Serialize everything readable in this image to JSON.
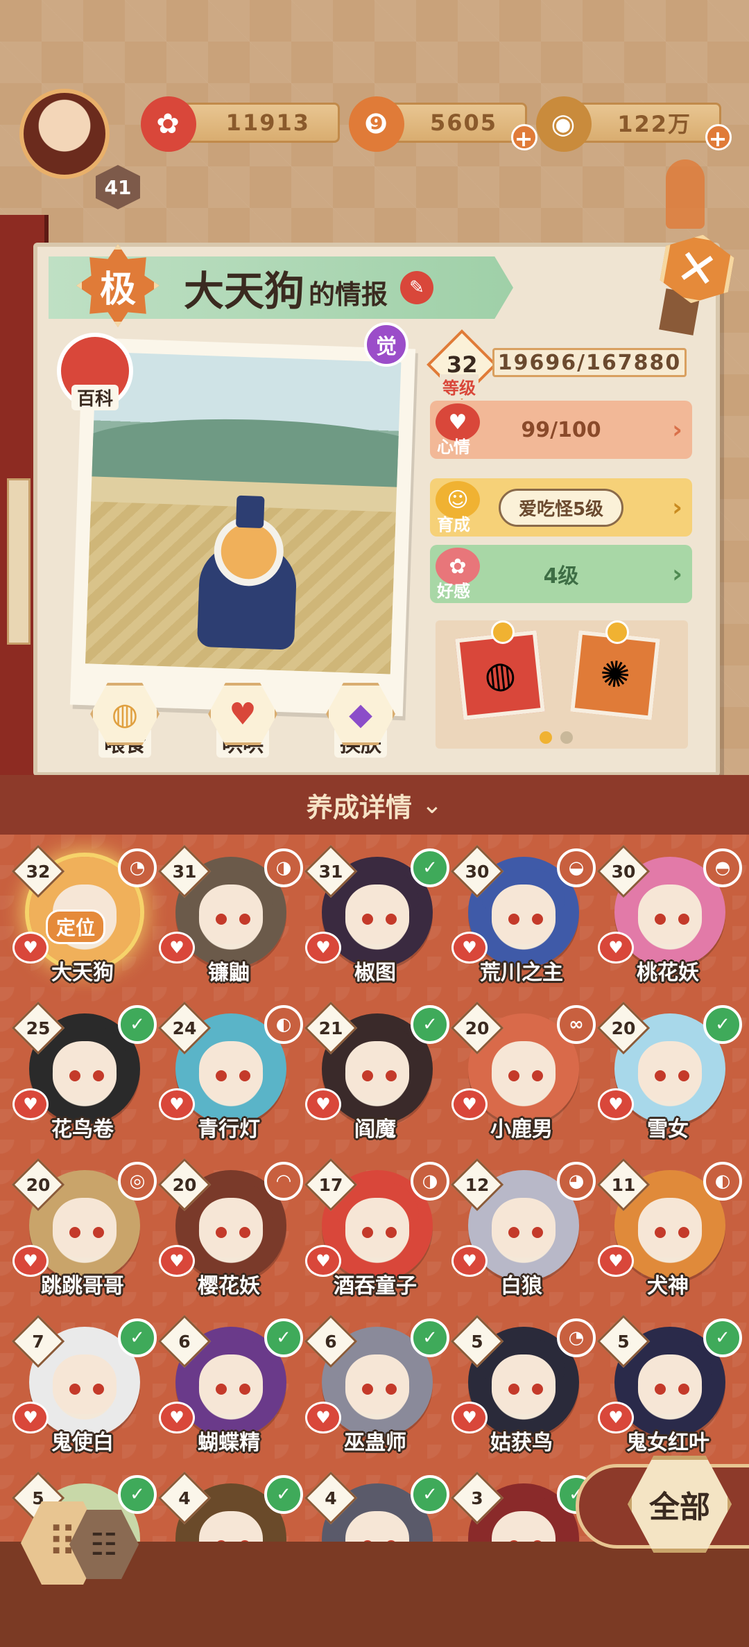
{
  "resources": {
    "player_level": "41",
    "currency1": "11913",
    "currency2": "5605",
    "currency3": "122万",
    "plus": "+"
  },
  "info": {
    "grade": "极",
    "name": "大天狗",
    "suffix": "的情报",
    "awaken": "觉",
    "wiki": "百科",
    "close": "✕",
    "edit": "✎"
  },
  "stats": {
    "level": "32",
    "level_caption": "等级",
    "exp": "19696/167880",
    "mood_caption": "心情",
    "mood_value": "99/100",
    "growth_caption": "育成",
    "growth_value": "爱吃怪5级",
    "affinity_caption": "好感",
    "affinity_value": "4级",
    "arrow": "›"
  },
  "actions": {
    "feed": "喂食",
    "coax": "哄哄",
    "skin": "换肤"
  },
  "roster": {
    "header": "养成详情",
    "chevron": "⌄",
    "locate": "定位",
    "heart": "♥",
    "items": [
      {
        "level": "32",
        "name": "大天狗",
        "tag": "skill",
        "tag_glyph": "◔",
        "color": "#f0b05a"
      },
      {
        "level": "31",
        "name": "镰鼬",
        "tag": "skill",
        "tag_glyph": "◑",
        "color": "#6b5a4a"
      },
      {
        "level": "31",
        "name": "椒图",
        "tag": "check",
        "tag_glyph": "✓",
        "color": "#3a2a40"
      },
      {
        "level": "30",
        "name": "荒川之主",
        "tag": "skill",
        "tag_glyph": "◒",
        "color": "#3f5aa8"
      },
      {
        "level": "30",
        "name": "桃花妖",
        "tag": "skill",
        "tag_glyph": "◓",
        "color": "#e27aa8"
      },
      {
        "level": "25",
        "name": "花鸟卷",
        "tag": "check",
        "tag_glyph": "✓",
        "color": "#2a2a2a"
      },
      {
        "level": "24",
        "name": "青行灯",
        "tag": "skill",
        "tag_glyph": "◐",
        "color": "#5ab4c8"
      },
      {
        "level": "21",
        "name": "阎魔",
        "tag": "check",
        "tag_glyph": "✓",
        "color": "#3a2a2a"
      },
      {
        "level": "20",
        "name": "小鹿男",
        "tag": "skill",
        "tag_glyph": "∞",
        "color": "#d96a4a"
      },
      {
        "level": "20",
        "name": "雪女",
        "tag": "check",
        "tag_glyph": "✓",
        "color": "#a8d8ea"
      },
      {
        "level": "20",
        "name": "跳跳哥哥",
        "tag": "skill",
        "tag_glyph": "◎",
        "color": "#c9a46a"
      },
      {
        "level": "20",
        "name": "樱花妖",
        "tag": "skill",
        "tag_glyph": "◠",
        "color": "#7a3a2a"
      },
      {
        "level": "17",
        "name": "酒吞童子",
        "tag": "skill",
        "tag_glyph": "◑",
        "color": "#d9473a"
      },
      {
        "level": "12",
        "name": "白狼",
        "tag": "skill",
        "tag_glyph": "◕",
        "color": "#b8b8c8"
      },
      {
        "level": "11",
        "name": "犬神",
        "tag": "skill",
        "tag_glyph": "◐",
        "color": "#e08a3a"
      },
      {
        "level": "7",
        "name": "鬼使白",
        "tag": "check",
        "tag_glyph": "✓",
        "color": "#eaeaea"
      },
      {
        "level": "6",
        "name": "蝴蝶精",
        "tag": "check",
        "tag_glyph": "✓",
        "color": "#6a3a8a"
      },
      {
        "level": "6",
        "name": "巫蛊师",
        "tag": "check",
        "tag_glyph": "✓",
        "color": "#8a8a9a"
      },
      {
        "level": "5",
        "name": "姑获鸟",
        "tag": "skill",
        "tag_glyph": "◔",
        "color": "#2a2a3a"
      },
      {
        "level": "5",
        "name": "鬼女红叶",
        "tag": "check",
        "tag_glyph": "✓",
        "color": "#2a2a4a"
      },
      {
        "level": "5",
        "name": "",
        "tag": "check",
        "tag_glyph": "✓",
        "color": "#c8d8a8"
      },
      {
        "level": "4",
        "name": "",
        "tag": "check",
        "tag_glyph": "✓",
        "color": "#6a4a2a"
      },
      {
        "level": "4",
        "name": "",
        "tag": "check",
        "tag_glyph": "✓",
        "color": "#5a5a6a"
      },
      {
        "level": "3",
        "name": "",
        "tag": "check",
        "tag_glyph": "✓",
        "color": "#8a2a2a"
      }
    ]
  },
  "bottom": {
    "grid_icon": "⠿",
    "list_icon": "☷",
    "filter": "全部"
  }
}
